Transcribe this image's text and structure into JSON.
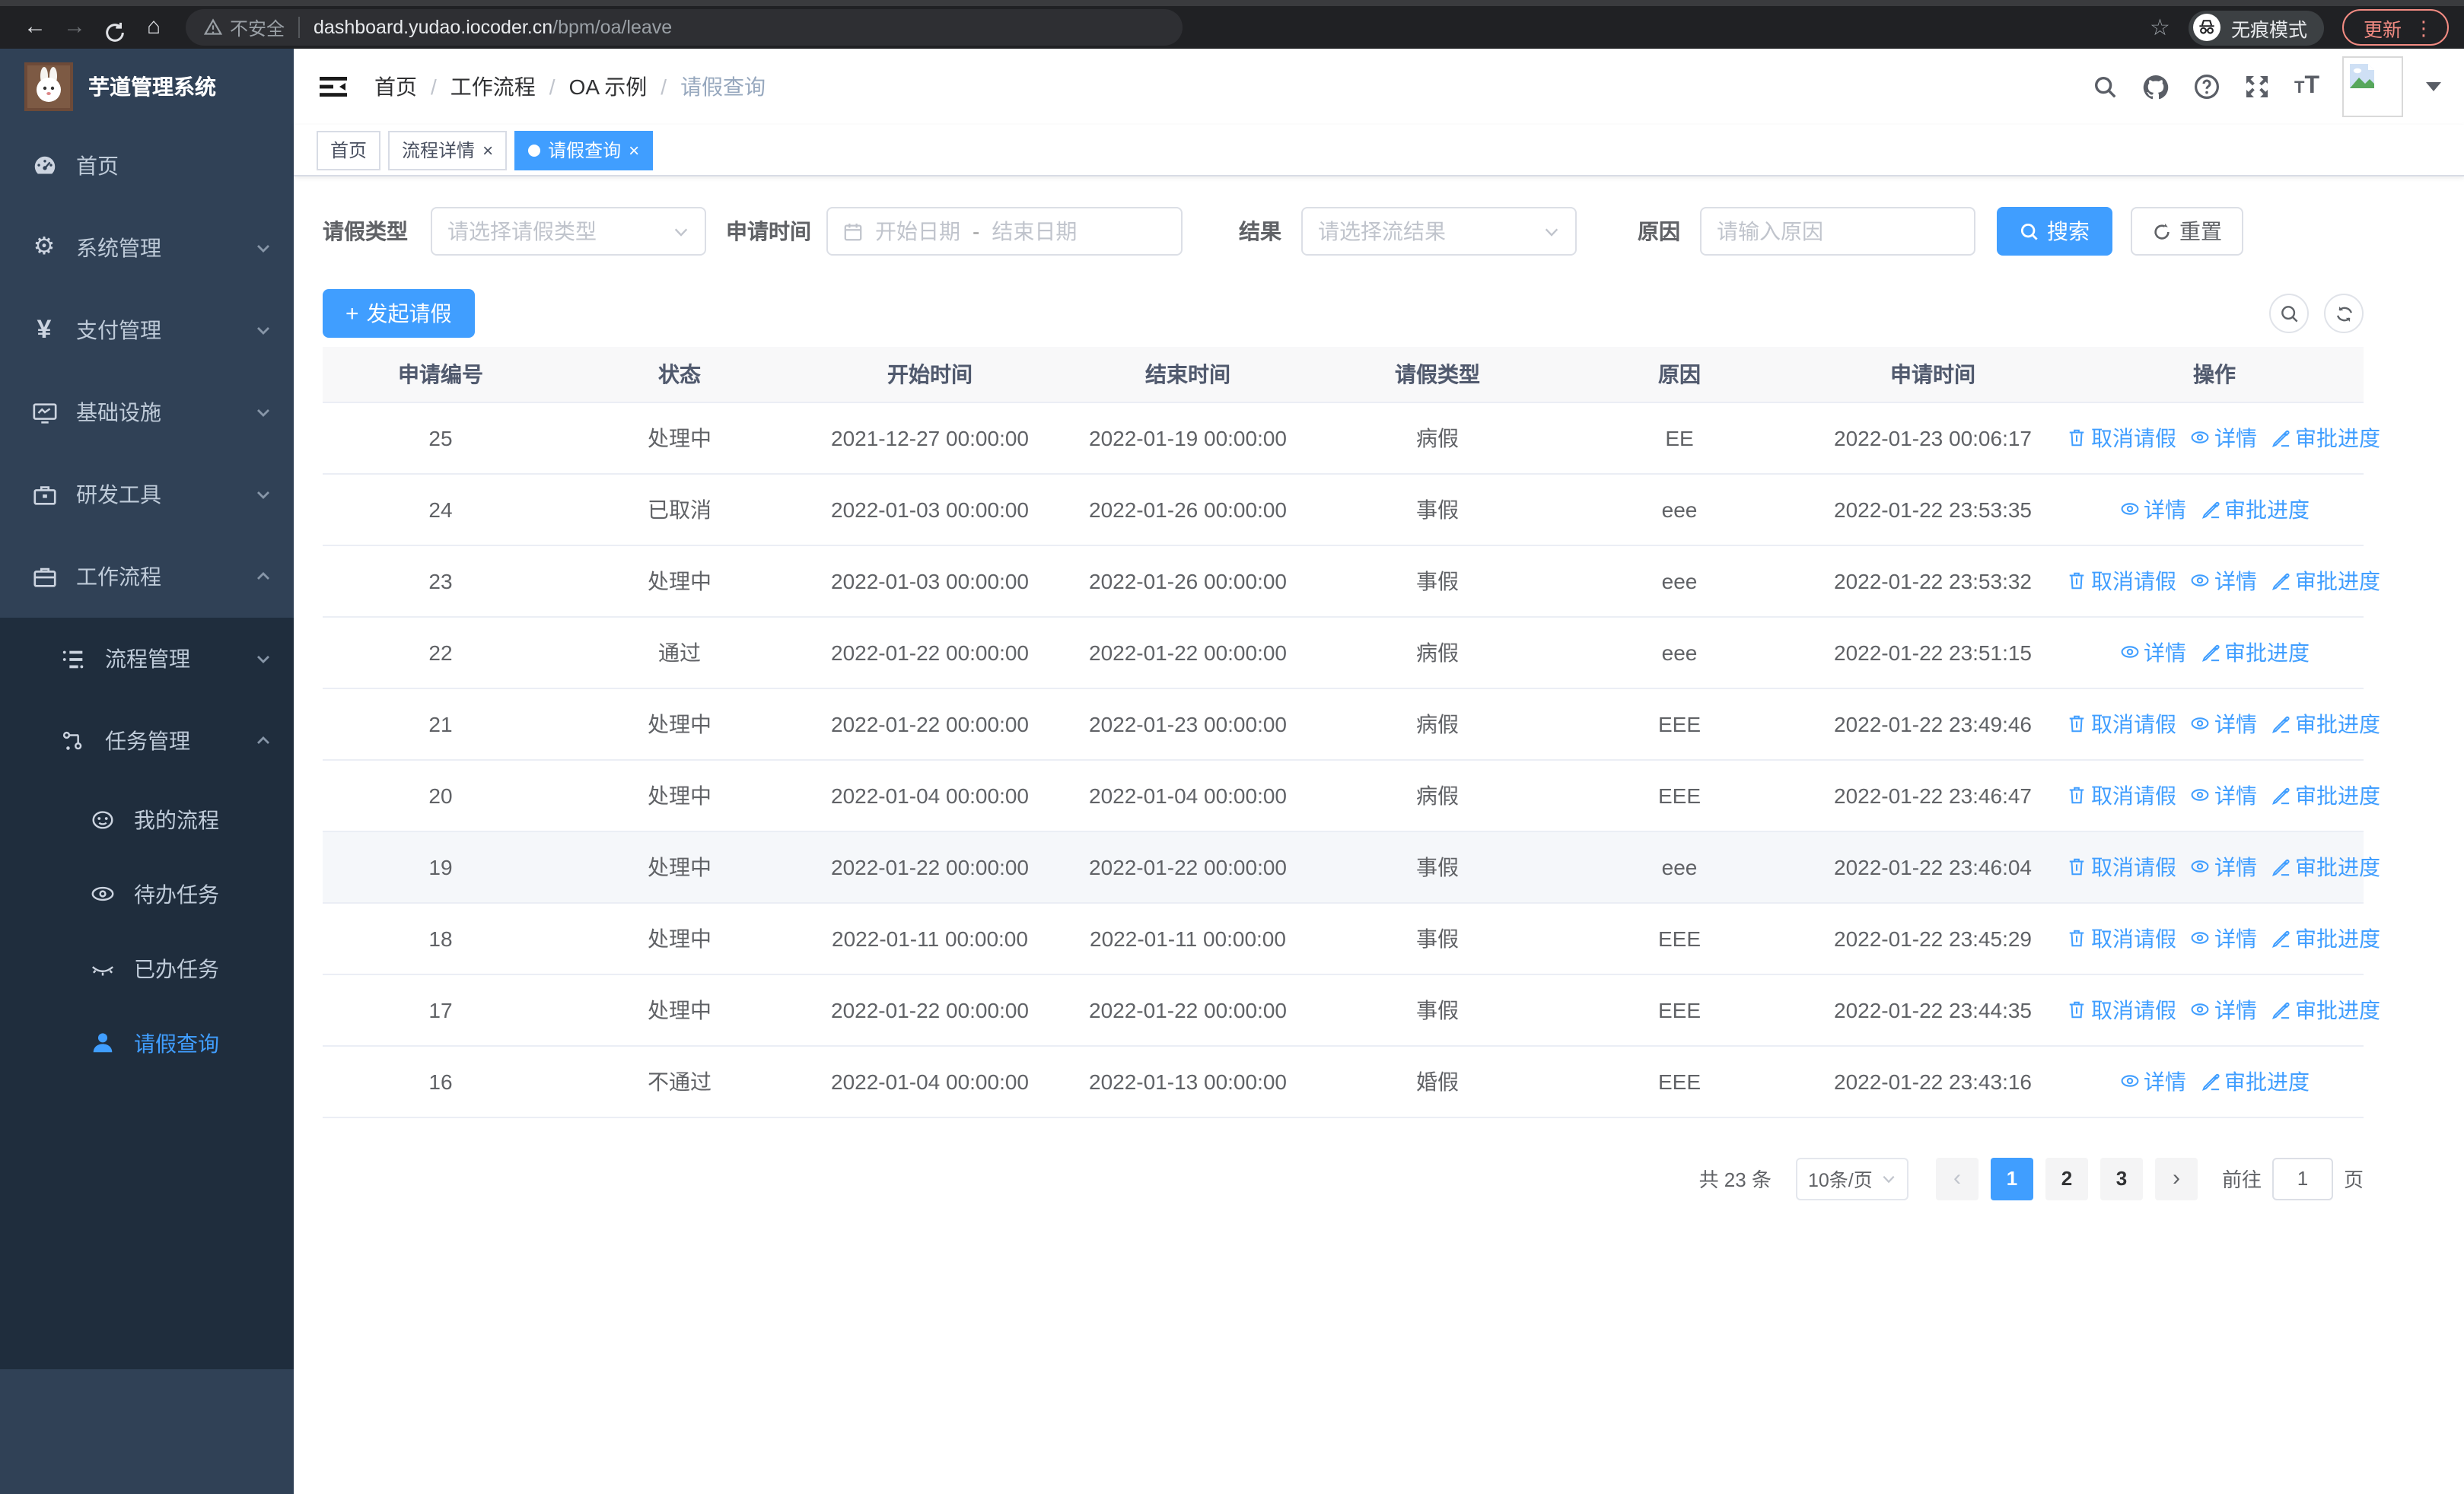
{
  "browser": {
    "security_label": "不安全",
    "url_host": "dashboard.yudao.iocoder.cn",
    "url_path": "/bpm/oa/leave",
    "incognito_label": "无痕模式",
    "update_label": "更新"
  },
  "sidebar": {
    "title": "芋道管理系统",
    "items": [
      {
        "label": "首页",
        "icon": "dashboard-icon"
      },
      {
        "label": "系统管理",
        "icon": "gear-icon"
      },
      {
        "label": "支付管理",
        "icon": "yen-icon"
      },
      {
        "label": "基础设施",
        "icon": "monitor-icon"
      },
      {
        "label": "研发工具",
        "icon": "toolbox-icon"
      },
      {
        "label": "工作流程",
        "icon": "briefcase-icon"
      }
    ],
    "sub": [
      {
        "label": "流程管理",
        "icon": "flow-list-icon"
      },
      {
        "label": "任务管理",
        "icon": "node-tree-icon"
      }
    ],
    "sub_children": [
      {
        "label": "我的流程",
        "icon": "face-icon"
      },
      {
        "label": "待办任务",
        "icon": "eye-icon"
      },
      {
        "label": "已办任务",
        "icon": "eye-closed-icon"
      },
      {
        "label": "请假查询",
        "icon": "user-icon",
        "active": true
      }
    ]
  },
  "breadcrumb": {
    "items": [
      "首页",
      "工作流程",
      "OA 示例",
      "请假查询"
    ]
  },
  "tabs": {
    "items": [
      {
        "label": "首页"
      },
      {
        "label": "流程详情"
      },
      {
        "label": "请假查询"
      }
    ]
  },
  "filters": {
    "leave_type_label": "请假类型",
    "leave_type_placeholder": "请选择请假类型",
    "apply_time_label": "申请时间",
    "start_date_placeholder": "开始日期",
    "range_separator": "-",
    "end_date_placeholder": "结束日期",
    "result_label": "结果",
    "result_placeholder": "请选择流结果",
    "reason_label": "原因",
    "reason_placeholder": "请输入原因",
    "search_label": "搜索",
    "reset_label": "重置"
  },
  "toolbar": {
    "create_label": "发起请假"
  },
  "table": {
    "columns": [
      "申请编号",
      "状态",
      "开始时间",
      "结束时间",
      "请假类型",
      "原因",
      "申请时间",
      "操作"
    ],
    "action_labels": {
      "cancel": "取消请假",
      "detail": "详情",
      "progress": "审批进度"
    },
    "rows": [
      {
        "id": "25",
        "status": "处理中",
        "start_time": "2021-12-27 00:00:00",
        "end_time": "2022-01-19 00:00:00",
        "type": "病假",
        "reason": "EE",
        "apply_time": "2022-01-23 00:06:17",
        "actions": [
          "cancel",
          "detail",
          "progress"
        ],
        "highlighted": false
      },
      {
        "id": "24",
        "status": "已取消",
        "start_time": "2022-01-03 00:00:00",
        "end_time": "2022-01-26 00:00:00",
        "type": "事假",
        "reason": "eee",
        "apply_time": "2022-01-22 23:53:35",
        "actions": [
          "detail",
          "progress"
        ],
        "highlighted": false
      },
      {
        "id": "23",
        "status": "处理中",
        "start_time": "2022-01-03 00:00:00",
        "end_time": "2022-01-26 00:00:00",
        "type": "事假",
        "reason": "eee",
        "apply_time": "2022-01-22 23:53:32",
        "actions": [
          "cancel",
          "detail",
          "progress"
        ],
        "highlighted": false
      },
      {
        "id": "22",
        "status": "通过",
        "start_time": "2022-01-22 00:00:00",
        "end_time": "2022-01-22 00:00:00",
        "type": "病假",
        "reason": "eee",
        "apply_time": "2022-01-22 23:51:15",
        "actions": [
          "detail",
          "progress"
        ],
        "highlighted": false
      },
      {
        "id": "21",
        "status": "处理中",
        "start_time": "2022-01-22 00:00:00",
        "end_time": "2022-01-23 00:00:00",
        "type": "病假",
        "reason": "EEE",
        "apply_time": "2022-01-22 23:49:46",
        "actions": [
          "cancel",
          "detail",
          "progress"
        ],
        "highlighted": false
      },
      {
        "id": "20",
        "status": "处理中",
        "start_time": "2022-01-04 00:00:00",
        "end_time": "2022-01-04 00:00:00",
        "type": "病假",
        "reason": "EEE",
        "apply_time": "2022-01-22 23:46:47",
        "actions": [
          "cancel",
          "detail",
          "progress"
        ],
        "highlighted": false
      },
      {
        "id": "19",
        "status": "处理中",
        "start_time": "2022-01-22 00:00:00",
        "end_time": "2022-01-22 00:00:00",
        "type": "事假",
        "reason": "eee",
        "apply_time": "2022-01-22 23:46:04",
        "actions": [
          "cancel",
          "detail",
          "progress"
        ],
        "highlighted": true
      },
      {
        "id": "18",
        "status": "处理中",
        "start_time": "2022-01-11 00:00:00",
        "end_time": "2022-01-11 00:00:00",
        "type": "事假",
        "reason": "EEE",
        "apply_time": "2022-01-22 23:45:29",
        "actions": [
          "cancel",
          "detail",
          "progress"
        ],
        "highlighted": false
      },
      {
        "id": "17",
        "status": "处理中",
        "start_time": "2022-01-22 00:00:00",
        "end_time": "2022-01-22 00:00:00",
        "type": "事假",
        "reason": "EEE",
        "apply_time": "2022-01-22 23:44:35",
        "actions": [
          "cancel",
          "detail",
          "progress"
        ],
        "highlighted": false
      },
      {
        "id": "16",
        "status": "不通过",
        "start_time": "2022-01-04 00:00:00",
        "end_time": "2022-01-13 00:00:00",
        "type": "婚假",
        "reason": "EEE",
        "apply_time": "2022-01-22 23:43:16",
        "actions": [
          "detail",
          "progress"
        ],
        "highlighted": false
      }
    ]
  },
  "pagination": {
    "total_label": "共 23 条",
    "page_size_label": "10条/页",
    "pages": [
      "1",
      "2",
      "3"
    ],
    "active_page": "1",
    "goto_label": "前往",
    "goto_value": "1",
    "unit_label": "页"
  },
  "colors": {
    "accent": "#409eff",
    "sidebar_bg": "#304156",
    "submenu_bg": "#1f2d3d",
    "active_tab_bg": "#409eff",
    "update_pill": "#f28b82",
    "table_header_bg": "#f8f8f9",
    "highlight_row_bg": "#f5f7fa",
    "link_blue": "#409eff"
  }
}
